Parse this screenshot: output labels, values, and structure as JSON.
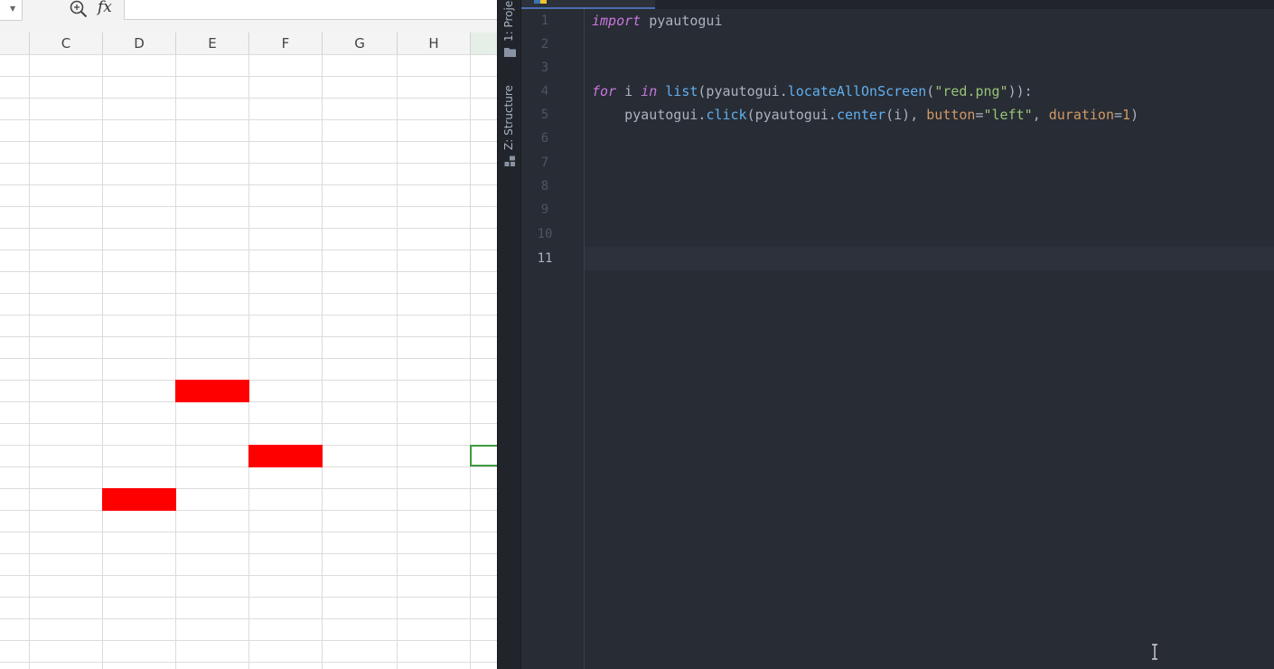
{
  "spreadsheet": {
    "formula_label": "fx",
    "formula_value": "",
    "columns": [
      "C",
      "D",
      "E",
      "F",
      "G",
      "H",
      ""
    ],
    "red_cells": [
      {
        "column": "E",
        "visible_row": 15
      },
      {
        "column": "F",
        "visible_row": 18
      },
      {
        "column": "D",
        "visible_row": 20
      }
    ],
    "colors": {
      "highlight": "#ff0000",
      "selection": "#3f9a3f"
    }
  },
  "ide": {
    "tool_tabs": {
      "project": "1: Proje",
      "structure": "Z: Structure"
    },
    "line_numbers": [
      "1",
      "2",
      "3",
      "4",
      "5",
      "6",
      "7",
      "8",
      "9",
      "10",
      "11"
    ],
    "current_line": "11",
    "code": {
      "line1": {
        "kw": "import",
        "rest": " pyautogui"
      },
      "line4": {
        "kw_for": "for",
        "var": " i ",
        "kw_in": "in",
        "sp": " ",
        "fn_list": "list",
        "p1": "(pyautogui.",
        "fn_locate": "locateAllOnScreen",
        "p2": "(",
        "str": "\"red.png\"",
        "p3": ")):"
      },
      "line5": {
        "indent": "    pyautogui.",
        "fn_click": "click",
        "p1": "(pyautogui.",
        "fn_center": "center",
        "p2": "(i), ",
        "param_button": "button",
        "eq1": "=",
        "str_left": "\"left\"",
        "comma": ", ",
        "param_duration": "duration",
        "eq2": "=",
        "num": "1",
        "close": ")"
      }
    },
    "colors": {
      "background": "#282c34",
      "keyword": "#c678dd",
      "function": "#61afef",
      "string": "#98c379",
      "number": "#d19a66"
    }
  }
}
